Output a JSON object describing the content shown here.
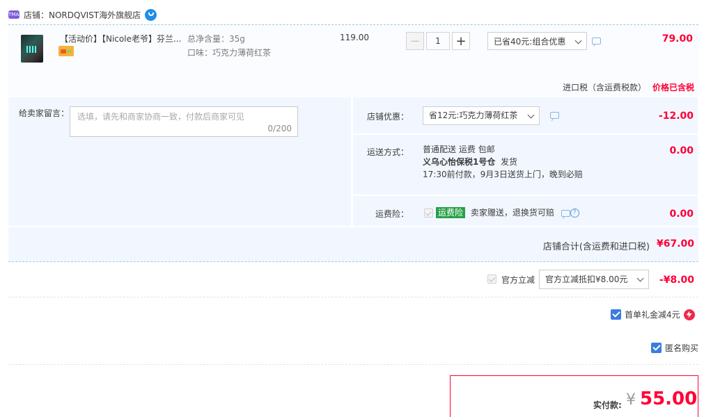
{
  "shop": {
    "label": "店铺：NORDQVIST海外旗舰店",
    "logo_text": "TMALL"
  },
  "item": {
    "title": "【活动价】【Nicole老爷】芬兰...",
    "spec_weight": "总净含量：35g",
    "spec_flavor": "口味：巧克力薄荷红茶",
    "unit_price": "119.00",
    "quantity": "1",
    "minus_label": "−",
    "plus_label": "+",
    "promo_selected": "已省40元:组合优惠",
    "total": "79.00",
    "tax_label": "进口税（含运费税款）",
    "tax_value": "价格已含税"
  },
  "message": {
    "label": "给卖家留言：",
    "placeholder": "选填，请先和商家协商一致，付款后商家可见",
    "count": "0/200"
  },
  "shop_discount": {
    "label": "店铺优惠：",
    "selected": "省12元:巧克力薄荷红茶",
    "value": "-12.00"
  },
  "shipping": {
    "label": "运送方式：",
    "line1": "普通配送 运费 包邮",
    "line2_bold": "义乌心怡保税1号仓",
    "line2_tail": "发货",
    "line3": "17:30前付款，9月3日送货上门，晚到必赔",
    "value": "0.00"
  },
  "insurance": {
    "label": "运费险：",
    "tag": "运费险",
    "text": "卖家赠送，退换货可赔",
    "help": "?",
    "value": "0.00"
  },
  "subtotal": {
    "label": "店铺合计(含运费和进口税)",
    "value": "¥67.00"
  },
  "official": {
    "label": "官方立减",
    "selected": "官方立减抵扣¥8.00元",
    "value": "-¥8.00"
  },
  "first_gift": {
    "label": "首单礼金减4元"
  },
  "anonymous": {
    "label": "匿名购买"
  },
  "payment": {
    "label": "实付款:",
    "yen": "¥",
    "value": "55.00"
  },
  "colors": {
    "price_red": "#ff0036",
    "accent_blue": "#3a7ce0",
    "panel_bg": "#f2f7ff",
    "insurance_green": "#27a148"
  }
}
